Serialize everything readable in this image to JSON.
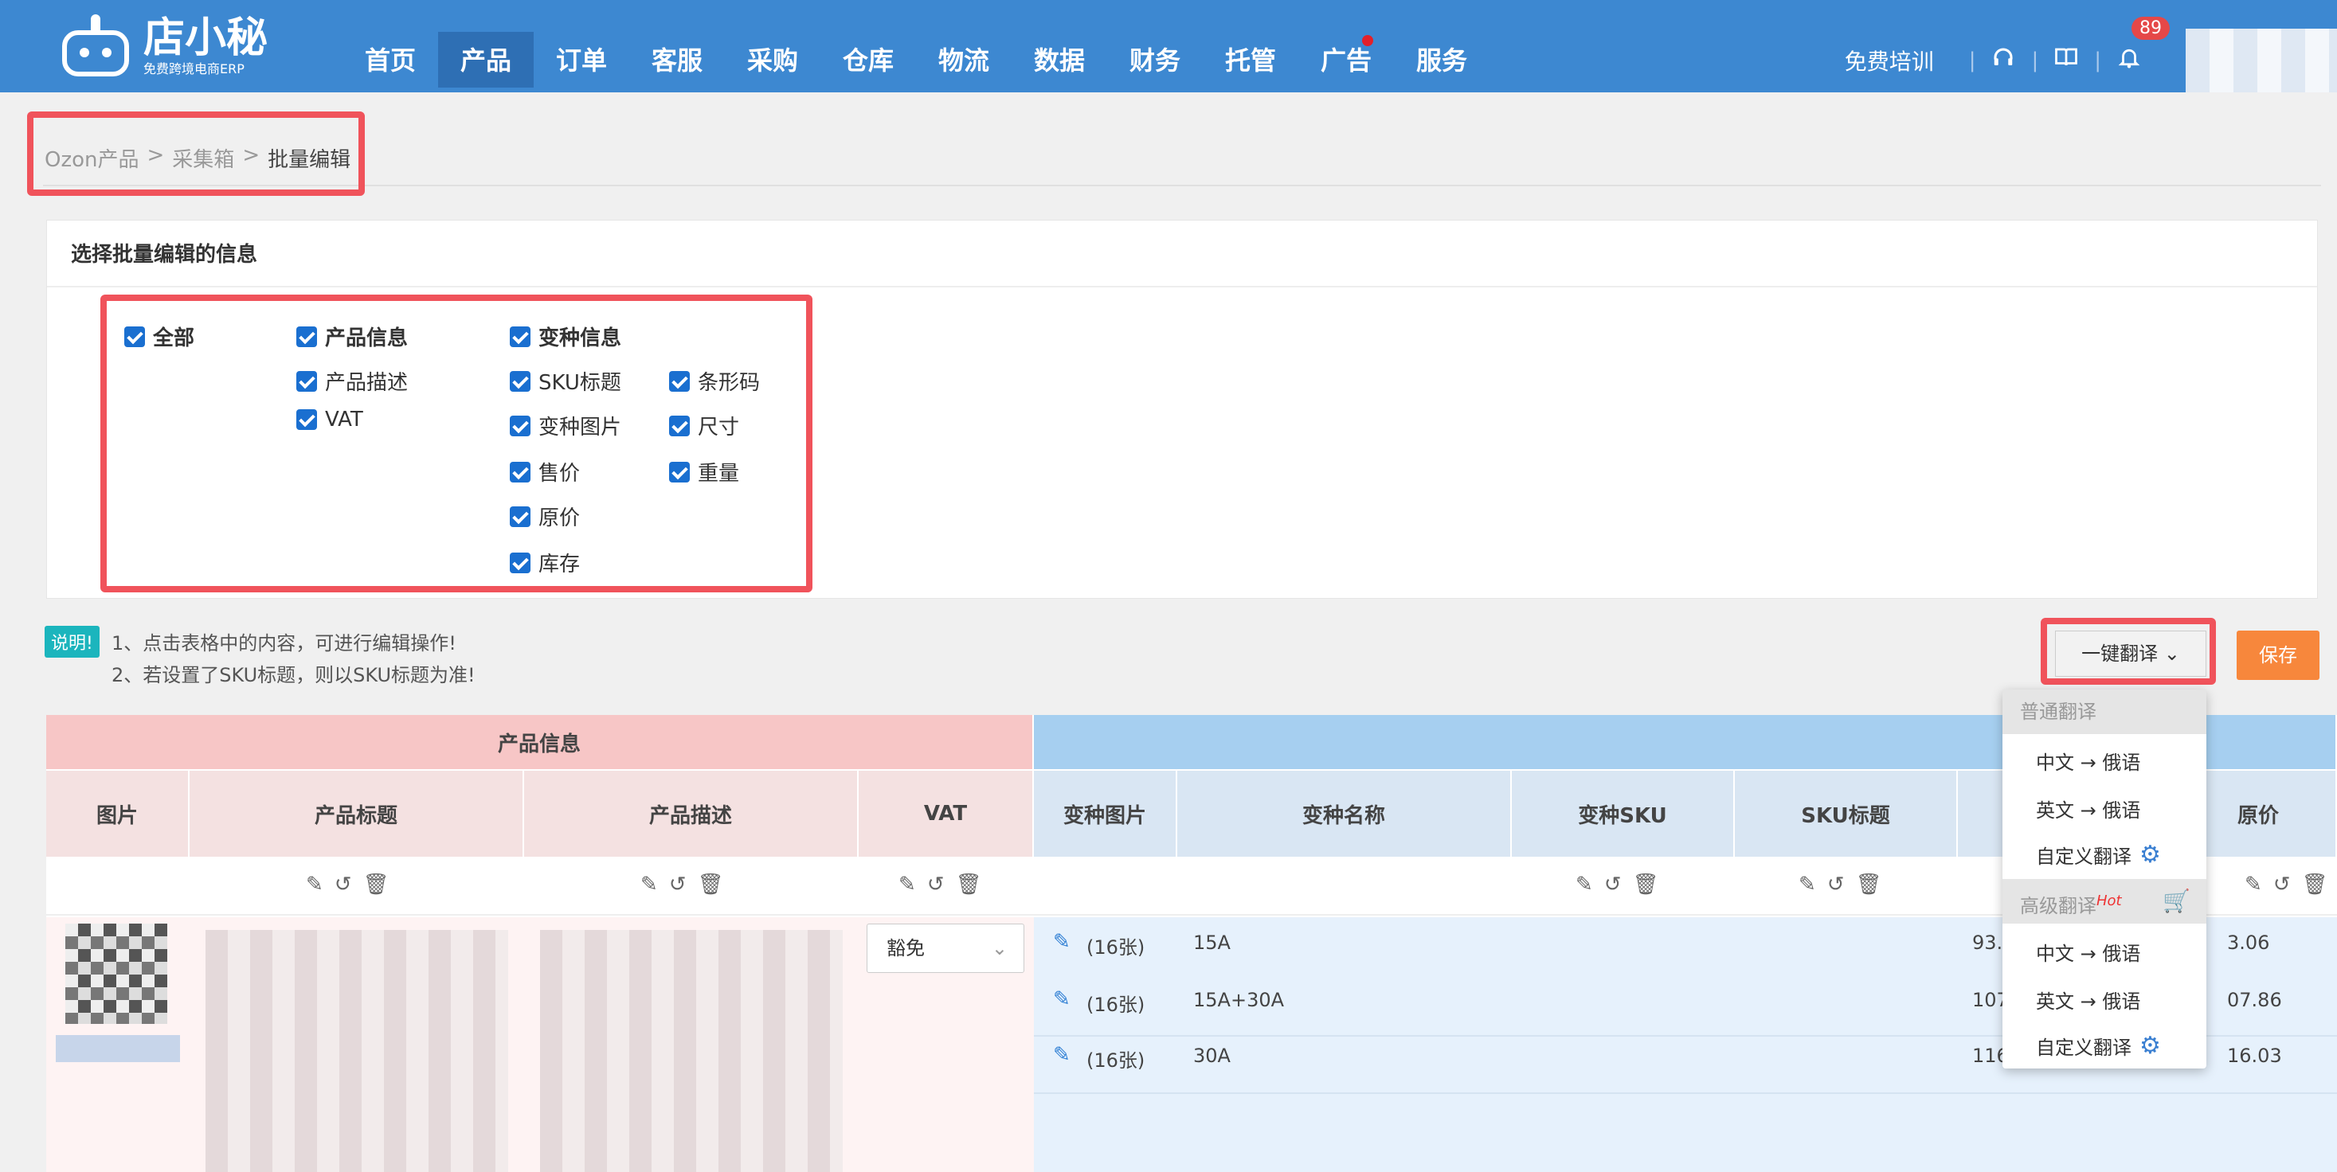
{
  "brand": {
    "name": "店小秘",
    "tagline": "免费跨境电商ERP"
  },
  "nav": {
    "items": [
      "首页",
      "产品",
      "订单",
      "客服",
      "采购",
      "仓库",
      "物流",
      "数据",
      "财务",
      "托管",
      "广告",
      "服务"
    ],
    "active": "产品"
  },
  "topright": {
    "free_training": "免费培训",
    "separator": "|",
    "notification_count": "89"
  },
  "breadcrumb": {
    "items": [
      "Ozon产品",
      "采集箱"
    ],
    "current": "批量编辑",
    "sep": ">"
  },
  "panel": {
    "title": "选择批量编辑的信息",
    "all": "全部",
    "product_info": "产品信息",
    "product_desc": "产品描述",
    "vat": "VAT",
    "variant_info": "变种信息",
    "variant_fields": [
      "SKU标题",
      "变种图片",
      "售价",
      "原价",
      "库存"
    ],
    "extra_fields": [
      "条形码",
      "尺寸",
      "重量"
    ]
  },
  "notes": {
    "tag": "说明!",
    "line1": "1、点击表格中的内容，可进行编辑操作!",
    "line2": "2、若设置了SKU标题，则以SKU标题为准!"
  },
  "buttons": {
    "translate": "一键翻译",
    "save": "保存"
  },
  "table": {
    "group_product": "产品信息",
    "headers": {
      "image": "图片",
      "title": "产品标题",
      "desc": "产品描述",
      "vat": "VAT",
      "variant_image": "变种图片",
      "variant_name": "变种名称",
      "variant_sku": "变种SKU",
      "sku_title": "SKU标题",
      "orig_price": "原价"
    },
    "vat_value": "豁免",
    "rows": [
      {
        "img": "(16张)",
        "name": "15A",
        "price": "93.",
        "orig": "3.06"
      },
      {
        "img": "(16张)",
        "name": "15A+30A",
        "price": "107",
        "orig": "07.86"
      },
      {
        "img": "(16张)",
        "name": "30A",
        "price": "116",
        "orig": "16.03"
      }
    ]
  },
  "dropdown": {
    "normal_header": "普通翻译",
    "normal_items": [
      "中文 → 俄语",
      "英文 → 俄语",
      "自定义翻译"
    ],
    "advanced_header": "高级翻译",
    "hot": "Hot",
    "advanced_items": [
      "中文 → 俄语",
      "英文 → 俄语",
      "自定义翻译"
    ]
  },
  "colors": {
    "nav": "#3d88d1",
    "highlight": "#f0535b",
    "save": "#f7873c",
    "checkbox": "#1a6fd0"
  }
}
